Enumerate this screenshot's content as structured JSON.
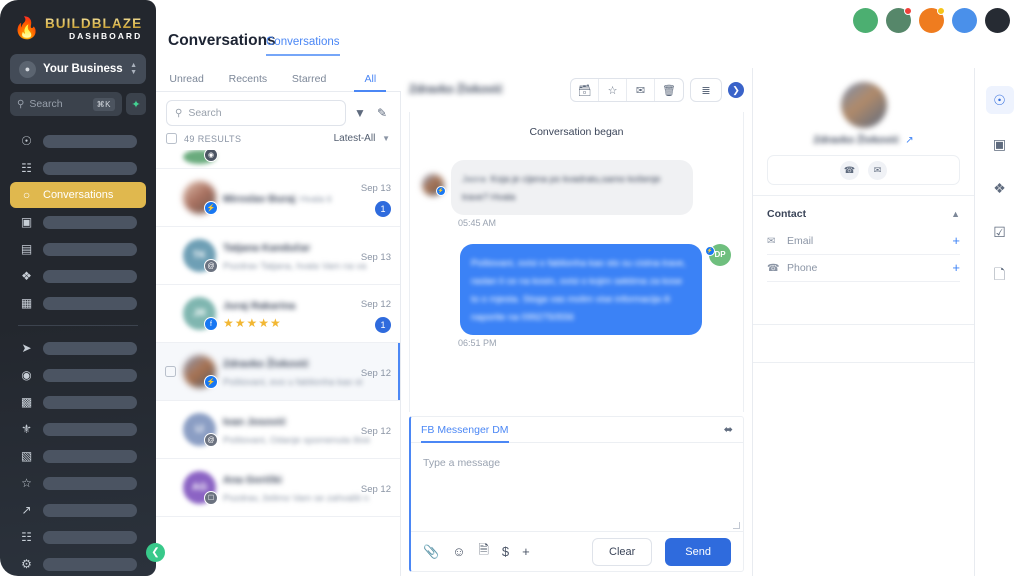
{
  "brand": {
    "flame_icon": "flame-icon",
    "name": "BUILDBLAZE",
    "subtitle": "DASHBOARD"
  },
  "sidebar": {
    "business_selector": {
      "label": "Your Business",
      "icon": "user-circle-icon",
      "chevron": "chevron-updown-icon"
    },
    "search": {
      "placeholder": "Search",
      "shortcut": "⌘K",
      "spark_icon": "sparkle-icon"
    },
    "nav_items": [
      {
        "icon": "launch-icon",
        "label": "",
        "redacted": true,
        "active": false
      },
      {
        "icon": "dashboard-grid-icon",
        "label": "",
        "redacted": true,
        "active": false
      },
      {
        "icon": "chat-bubble-icon",
        "label": "Conversations",
        "redacted": false,
        "active": true
      },
      {
        "icon": "calendar-icon",
        "label": "",
        "redacted": true,
        "active": false
      },
      {
        "icon": "contacts-book-icon",
        "label": "",
        "redacted": true,
        "active": false
      },
      {
        "icon": "automation-nodes-icon",
        "label": "",
        "redacted": true,
        "active": false
      },
      {
        "icon": "receipt-dollar-icon",
        "label": "",
        "redacted": true,
        "active": false
      }
    ],
    "nav_items_lower": [
      {
        "icon": "paper-plane-icon",
        "label": "",
        "redacted": true
      },
      {
        "icon": "play-circle-icon",
        "label": "",
        "redacted": true
      },
      {
        "icon": "payment-card-icon",
        "label": "",
        "redacted": true
      },
      {
        "icon": "award-ribbon-icon",
        "label": "",
        "redacted": true
      },
      {
        "icon": "image-icon",
        "label": "",
        "redacted": true
      },
      {
        "icon": "star-icon",
        "label": "",
        "redacted": true
      },
      {
        "icon": "trending-up-icon",
        "label": "",
        "redacted": true
      },
      {
        "icon": "apps-grid-icon",
        "label": "",
        "redacted": true
      },
      {
        "icon": "gear-icon",
        "label": "",
        "redacted": true
      }
    ],
    "collapse_button": {
      "icon": "chevron-left-icon"
    }
  },
  "window_dots": [
    {
      "name": "dot-green",
      "color": "#4caf71",
      "badge": null
    },
    {
      "name": "dot-green-alert",
      "color": "#56876a",
      "badge": "#f0403a"
    },
    {
      "name": "dot-orange",
      "color": "#ef7c1f",
      "badge": "#f5c518"
    },
    {
      "name": "dot-blue",
      "color": "#4a90ea",
      "badge": null
    },
    {
      "name": "dot-dark",
      "color": "#262b33",
      "badge": null
    }
  ],
  "header": {
    "page_title": "Conversations",
    "active_tab": "Conversations"
  },
  "filter_tabs": [
    {
      "label": "Unread",
      "active": false
    },
    {
      "label": "Recents",
      "active": false
    },
    {
      "label": "Starred",
      "active": false
    },
    {
      "label": "All",
      "active": true
    }
  ],
  "list": {
    "search_placeholder": "Search",
    "filter_icon": "funnel-icon",
    "compose_icon": "compose-pencil-icon",
    "results_count": "49 RESULTS",
    "sort_label": "Latest-All",
    "sort_chevron": "chevron-down-icon",
    "items": [
      {
        "name": "",
        "snippet": "",
        "date": "",
        "unread": null,
        "avatar_color": "#6aab7d",
        "avatar_initials": "",
        "channel": "instagram-icon",
        "channel_color": "#4b5563",
        "selected": false,
        "partial": true,
        "stars": 0
      },
      {
        "name": "Miroslav Ðuraj",
        "snippet": "Hvala ti",
        "date": "Sep 13",
        "unread": "1",
        "avatar_color": "#c9a79a",
        "avatar_initials": "",
        "channel": "messenger-icon",
        "channel_color": "#1877f2",
        "selected": false,
        "partial": false,
        "stars": 0
      },
      {
        "name": "Tatjana Kandučar",
        "snippet": "Pozdrav Tatjana, hvala Vam na va",
        "date": "Sep 13",
        "unread": null,
        "avatar_color": "#6e9fb5",
        "avatar_initials": "TK",
        "channel": "at-mail-icon",
        "channel_color": "#6b7280",
        "selected": false,
        "partial": false,
        "stars": 0
      },
      {
        "name": "Juraj Rakarina",
        "snippet": "",
        "date": "Sep 12",
        "unread": "1",
        "avatar_color": "#7fb6b0",
        "avatar_initials": "JR",
        "channel": "facebook-icon",
        "channel_color": "#1877f2",
        "selected": false,
        "partial": false,
        "stars": 5
      },
      {
        "name": "Zdravko Živković",
        "snippet": "Poštovani, evo u fablionha kao st",
        "date": "Sep 12",
        "unread": null,
        "avatar_color": "#8d7f6e",
        "avatar_initials": "",
        "channel": "messenger-icon",
        "channel_color": "#1877f2",
        "selected": true,
        "partial": false,
        "stars": 0
      },
      {
        "name": "Ivan Josović",
        "snippet": "Poštovani, Odanje spomenuta štve",
        "date": "Sep 12",
        "unread": null,
        "avatar_color": "#8b9ec4",
        "avatar_initials": "IJ",
        "channel": "at-mail-icon",
        "channel_color": "#6b7280",
        "selected": false,
        "partial": false,
        "stars": 0
      },
      {
        "name": "Ana Gorički",
        "snippet": "Pozdrav, želimo Vam se zahvaliti n",
        "date": "Sep 12",
        "unread": null,
        "avatar_color": "#8b63c4",
        "avatar_initials": "AG",
        "channel": "sms-icon",
        "channel_color": "#6b7280",
        "selected": false,
        "partial": false,
        "stars": 0
      }
    ]
  },
  "thread": {
    "title": "Zdravko Živković",
    "toolbar": [
      {
        "name": "archive-button",
        "icon": "folder-minus-icon"
      },
      {
        "name": "star-button",
        "icon": "star-icon"
      },
      {
        "name": "mark-unread-button",
        "icon": "envelope-icon"
      },
      {
        "name": "delete-button",
        "icon": "trash-icon"
      }
    ],
    "filter_button": {
      "name": "filter-button",
      "icon": "filter-lines-icon"
    },
    "next_button": {
      "name": "next-conversation-button",
      "icon": "chevron-right-icon"
    },
    "began_label": "Conversation began",
    "messages": [
      {
        "direction": "in",
        "sender": "Jasna",
        "text": "Koja je cijena po kvadratu,samo košenje trave? Hvala",
        "time": "05:45 AM",
        "avatar_initials": "",
        "avatar_color": "#7d6a58",
        "channel": "messenger-icon"
      },
      {
        "direction": "out",
        "sender": "DP",
        "text": "Poštovani, ovisi o fablionha kao sto su cistna trave, raslan li ce na kosin, ovisi o kojim sektima za kose to o mjesta. Stoga vas molim vise informacija ili naporite na 0992750556",
        "time": "06:51 PM",
        "avatar_initials": "DP",
        "avatar_color": "#6fbf7e",
        "channel": "messenger-icon"
      }
    ]
  },
  "composer": {
    "tab_label": "FB Messenger DM",
    "expand_icon": "expand-arrows-icon",
    "placeholder": "Type a message",
    "tools": [
      {
        "name": "attachment-button",
        "icon": "paperclip-icon",
        "glyph": "📎"
      },
      {
        "name": "emoji-button",
        "icon": "smiley-icon",
        "glyph": "☺"
      },
      {
        "name": "template-button",
        "icon": "document-icon",
        "glyph": "🗎"
      },
      {
        "name": "payment-button",
        "icon": "dollar-icon",
        "glyph": "$"
      },
      {
        "name": "add-more-button",
        "icon": "plus-icon",
        "glyph": "+"
      }
    ],
    "clear_label": "Clear",
    "send_label": "Send"
  },
  "contact_panel": {
    "name": "Zdravko Živković",
    "external_link_icon": "external-link-icon",
    "actions": [
      {
        "name": "call-button",
        "icon": "phone-icon"
      },
      {
        "name": "email-button",
        "icon": "envelope-icon"
      }
    ],
    "section_title": "Contact",
    "collapse_icon": "chevron-up-icon",
    "fields": [
      {
        "label": "Email",
        "icon": "envelope-icon",
        "add_icon": "plus-icon"
      },
      {
        "label": "Phone",
        "icon": "phone-icon",
        "add_icon": "plus-icon"
      }
    ]
  },
  "right_rail": [
    {
      "name": "rail-contact",
      "icon": "user-circle-icon",
      "active": true
    },
    {
      "name": "rail-calendar",
      "icon": "calendar-icon",
      "active": false
    },
    {
      "name": "rail-automation",
      "icon": "automation-nodes-icon",
      "active": false
    },
    {
      "name": "rail-tasks",
      "icon": "checkbox-icon",
      "active": false
    },
    {
      "name": "rail-notes",
      "icon": "document-icon",
      "active": false
    }
  ],
  "colors": {
    "brand_gold": "#e0b84e",
    "accent_blue": "#2f6bdd",
    "link_blue": "#4b87f5",
    "sidebar_bg": "#23272e",
    "star_gold": "#f2b733"
  }
}
